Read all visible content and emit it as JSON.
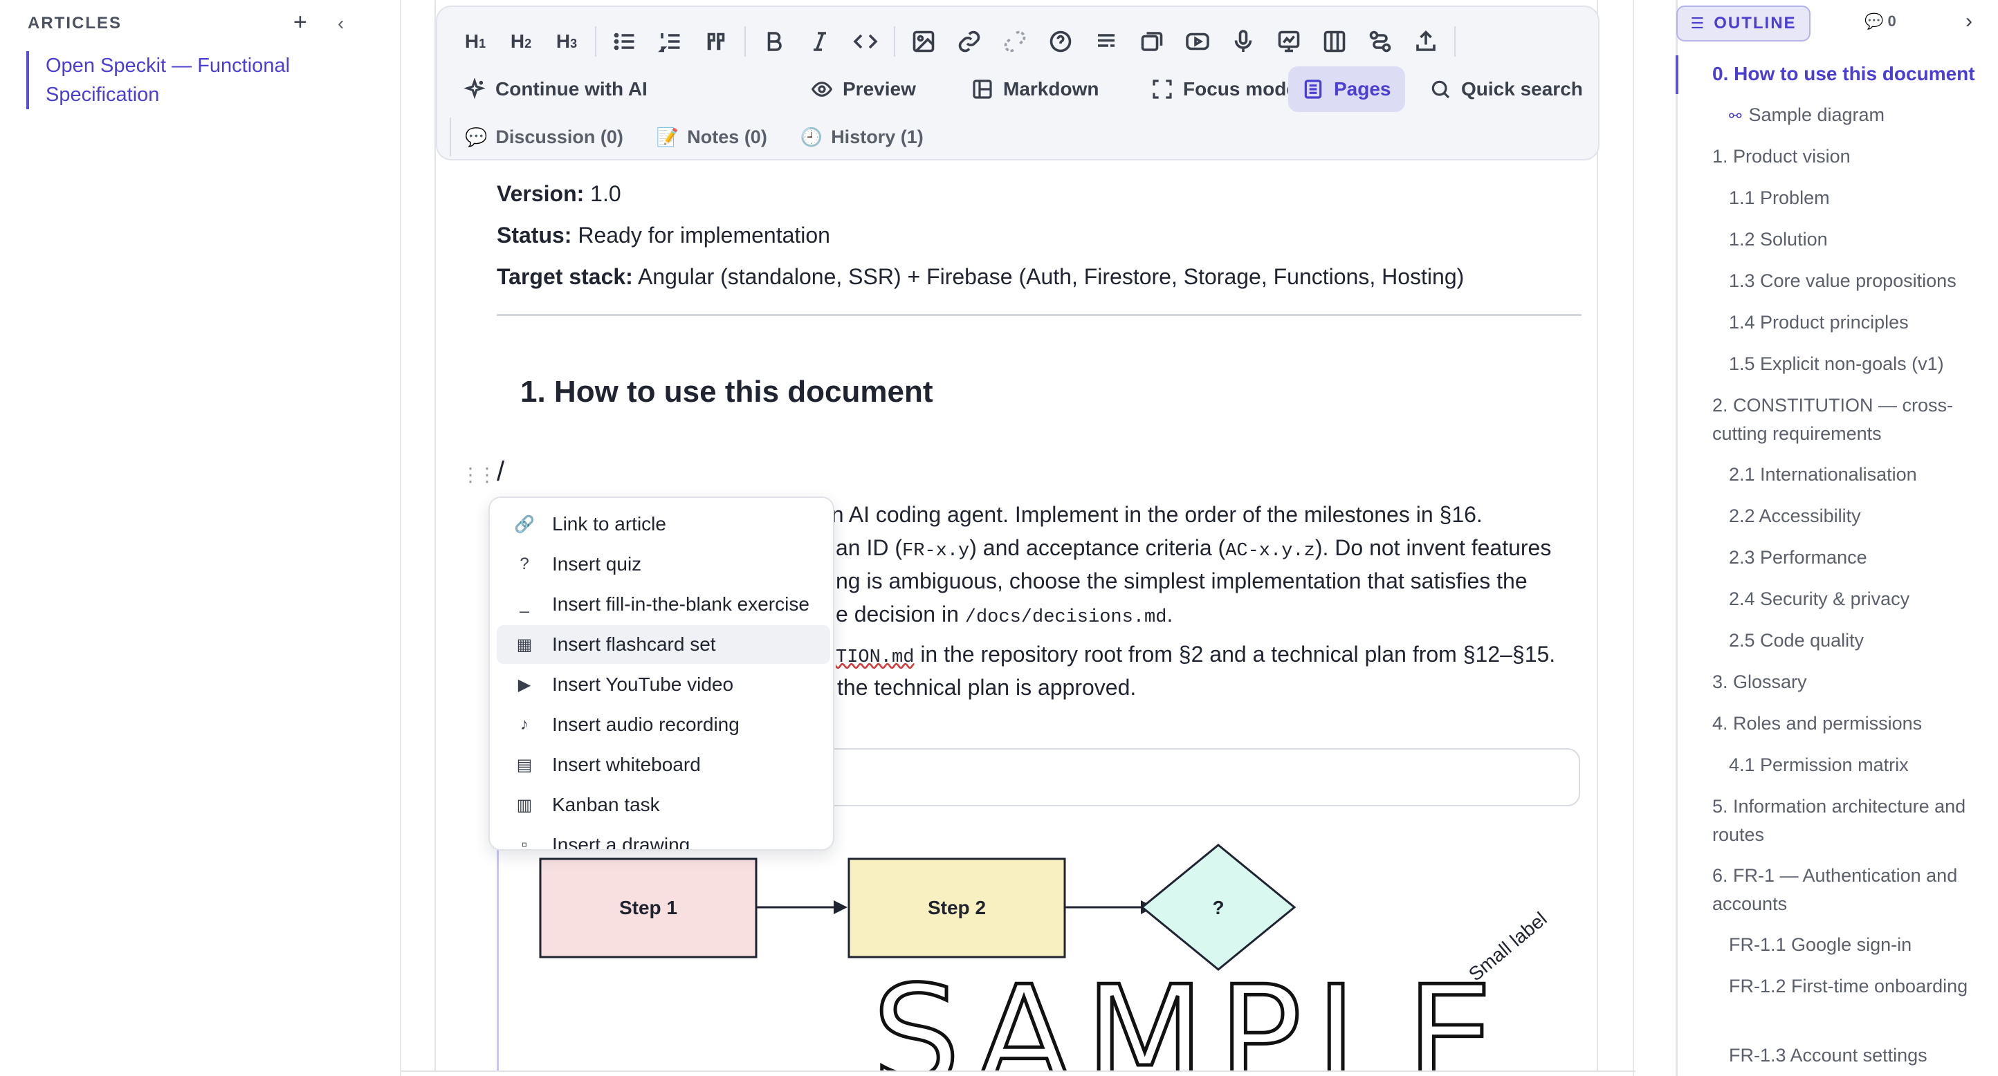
{
  "sidebar": {
    "header": "ARTICLES",
    "add_icon": "plus-icon",
    "collapse_icon": "chevron-left-icon",
    "articles": [
      "Open Speckit — Functional Specification"
    ]
  },
  "toolbar": {
    "headings": [
      "H1",
      "H2",
      "H3"
    ],
    "icons": [
      "bullet-list-icon",
      "numbered-list-icon",
      "quote-icon",
      "bold-icon",
      "italic-icon",
      "code-icon",
      "image-icon",
      "link-icon",
      "unlink-icon",
      "help-icon",
      "text-format-icon",
      "flashcard-icon",
      "youtube-icon",
      "microphone-icon",
      "whiteboard-icon",
      "columns-icon",
      "diagram-icon",
      "export-icon"
    ],
    "continue_ai": "Continue with AI",
    "preview": "Preview",
    "markdown": "Markdown",
    "focus_mode": "Focus mode",
    "pages": "Pages",
    "quick_search": "Quick search",
    "discussion": "Discussion (0)",
    "notes": "Notes (0)",
    "history": "History (1)"
  },
  "doc": {
    "version_label": "Version:",
    "version_value": " 1.0",
    "status_label": "Status:",
    "status_value": " Ready for implementation",
    "stack_label": "Target stack:",
    "stack_value": " Angular (standalone, SSR) + Firebase (Auth, Firestore, Storage, Functions, Hosting)",
    "heading": "1. How to use this document",
    "slash": "/",
    "p1_l1": " an AI coding agent. Implement in the order of the milestones in §16.",
    "p1_l2a": "an ID (",
    "p1_l2_code1": "FR-x.y",
    "p1_l2b": ") and acceptance criteria (",
    "p1_l2_code2": "AC-x.y.z",
    "p1_l2c": "). Do not invent features",
    "p1_l3": "ng is ambiguous, choose the simplest implementation that satisfies the",
    "p1_l4a": "e decision in ",
    "p1_l4_code": "/docs/decisions.md",
    "p1_l4b": ".",
    "p2_l1_code": "TION.md",
    "p2_l1b": " in the repository root from §2 and a technical plan from §12–§15.",
    "p2_l2": " the technical plan is approved."
  },
  "slash_menu": {
    "items": [
      {
        "label": "Link to article",
        "icon": "link-icon",
        "glyph": "🔗"
      },
      {
        "label": "Insert quiz",
        "icon": "question-icon",
        "glyph": "?"
      },
      {
        "label": "Insert fill-in-the-blank exercise",
        "icon": "blank-icon",
        "glyph": "_"
      },
      {
        "label": "Insert flashcard set",
        "icon": "flashcard-icon",
        "glyph": "▦"
      },
      {
        "label": "Insert YouTube video",
        "icon": "play-icon",
        "glyph": "▶"
      },
      {
        "label": "Insert audio recording",
        "icon": "music-note-icon",
        "glyph": "♪"
      },
      {
        "label": "Insert whiteboard",
        "icon": "whiteboard-icon",
        "glyph": "▤"
      },
      {
        "label": "Kanban task",
        "icon": "kanban-icon",
        "glyph": "▥"
      },
      {
        "label": "Insert a drawing",
        "icon": "drawing-icon",
        "glyph": "▫"
      }
    ],
    "selected_index": 3
  },
  "diagram": {
    "step1": "Step 1",
    "step2": "Step 2",
    "decision": "?",
    "handwriting": "SAMPLE",
    "small_label": "Small label"
  },
  "outline": {
    "button_label": "OUTLINE",
    "comment_count": "0",
    "items": [
      {
        "label": "0. How to use this document",
        "level": 0,
        "active": true
      },
      {
        "label": "Sample diagram",
        "level": 1
      },
      {
        "label": "1. Product vision",
        "level": 0
      },
      {
        "label": "1.1 Problem",
        "level": 1
      },
      {
        "label": "1.2 Solution",
        "level": 1
      },
      {
        "label": "1.3 Core value propositions",
        "level": 1
      },
      {
        "label": "1.4 Product principles",
        "level": 1
      },
      {
        "label": "1.5 Explicit non-goals (v1)",
        "level": 1
      },
      {
        "label": "2. CONSTITUTION — cross-cutting requirements",
        "level": 0
      },
      {
        "label": "2.1 Internationalisation",
        "level": 1
      },
      {
        "label": "2.2 Accessibility",
        "level": 1
      },
      {
        "label": "2.3 Performance",
        "level": 1
      },
      {
        "label": "2.4 Security & privacy",
        "level": 1
      },
      {
        "label": "2.5 Code quality",
        "level": 1
      },
      {
        "label": "3. Glossary",
        "level": 0
      },
      {
        "label": "4. Roles and permissions",
        "level": 0
      },
      {
        "label": "4.1 Permission matrix",
        "level": 1
      },
      {
        "label": "5. Information architecture and routes",
        "level": 0
      },
      {
        "label": "6. FR-1 — Authentication and accounts",
        "level": 0
      },
      {
        "label": "FR-1.1 Google sign-in",
        "level": 1
      },
      {
        "label": "FR-1.2 First-time onboarding",
        "level": 1
      },
      {
        "label": "FR-1.3 Account settings",
        "level": 1
      }
    ]
  },
  "colors": {
    "accent": "#4a3fd0",
    "step1_fill": "#f8e0e0",
    "step2_fill": "#f8f0c0",
    "decision_fill": "#d8f8f0"
  }
}
